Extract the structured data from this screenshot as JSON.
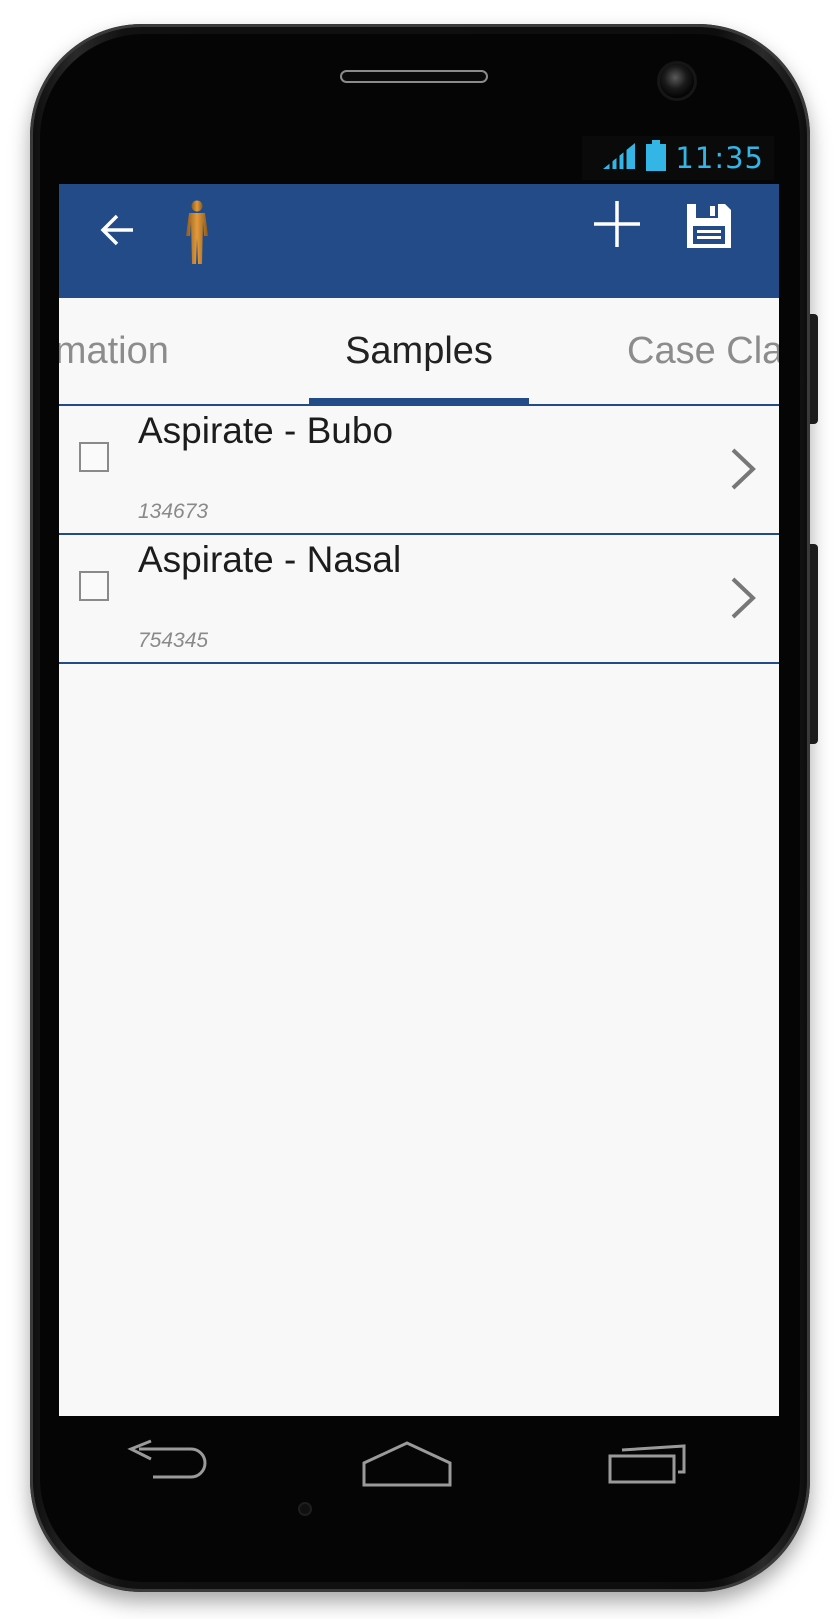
{
  "status_bar": {
    "time": "11:35",
    "accent_color": "#33b5e5",
    "icons": [
      "signal-icon",
      "battery-icon"
    ]
  },
  "action_bar": {
    "color": "#224b87",
    "back_icon": "arrow-left-icon",
    "app_icon": "person-figure-icon",
    "add_icon": "plus-icon",
    "save_icon": "floppy-disk-icon"
  },
  "tabs": [
    {
      "label": "ormation",
      "selected": false
    },
    {
      "label": "Samples",
      "selected": true
    },
    {
      "label": "Case Cla",
      "selected": false
    }
  ],
  "samples": [
    {
      "title": "Aspirate - Bubo",
      "id": "134673",
      "checked": false
    },
    {
      "title": "Aspirate - Nasal",
      "id": "754345",
      "checked": false
    }
  ],
  "nav_bar": {
    "icons": [
      "back-nav-icon",
      "home-nav-icon",
      "recents-nav-icon"
    ]
  }
}
